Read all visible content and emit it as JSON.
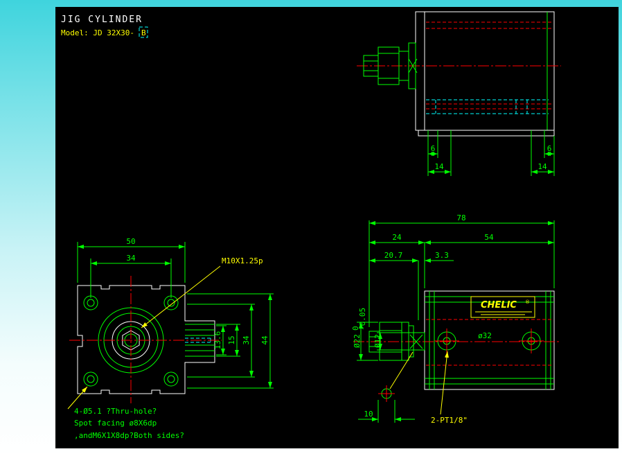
{
  "title": {
    "product": "JIG CYLINDER",
    "model_prefix": "Model: JD 32X30-",
    "model_suffix": "B"
  },
  "palette": {
    "geometry": "#00ff00",
    "outline": "#ffffff",
    "centerline": "#ff0000",
    "hidden": "#00ffff",
    "label": "#ffff00",
    "canvas": "#000000"
  },
  "top_view": {
    "dim_left_6": "6",
    "dim_left_14": "14",
    "dim_right_6": "6",
    "dim_right_14": "14"
  },
  "front_view": {
    "dim_width_outer": "50",
    "dim_width_holes": "34",
    "dim_h_13_6": "13.6",
    "dim_h_15": "15",
    "dim_h_34": "34",
    "dim_h_44": "44",
    "thread_label": "M10X1.25p",
    "note_line1": "4-Ø5.1 ?Thru-hole?",
    "note_line2": "Spot facing ø8X6dp",
    "note_line3": ",andM6X1X8dp?Both sides?"
  },
  "section_view": {
    "dim_total": "78",
    "dim_left": "24",
    "dim_right": "54",
    "dim_rod": "20.7",
    "dim_gap": "3.3",
    "dim_pin": "10",
    "dia_rod_end": "Ø22",
    "dia_rod_end_tol_upper": "0",
    "dia_rod_end_tol_lower": "-0.05",
    "dia_rod": "Ø12",
    "bore_label": "ø32",
    "port_label": "2-PT1/8\"",
    "logo_text": "CHELIC",
    "logo_reg": "®"
  }
}
